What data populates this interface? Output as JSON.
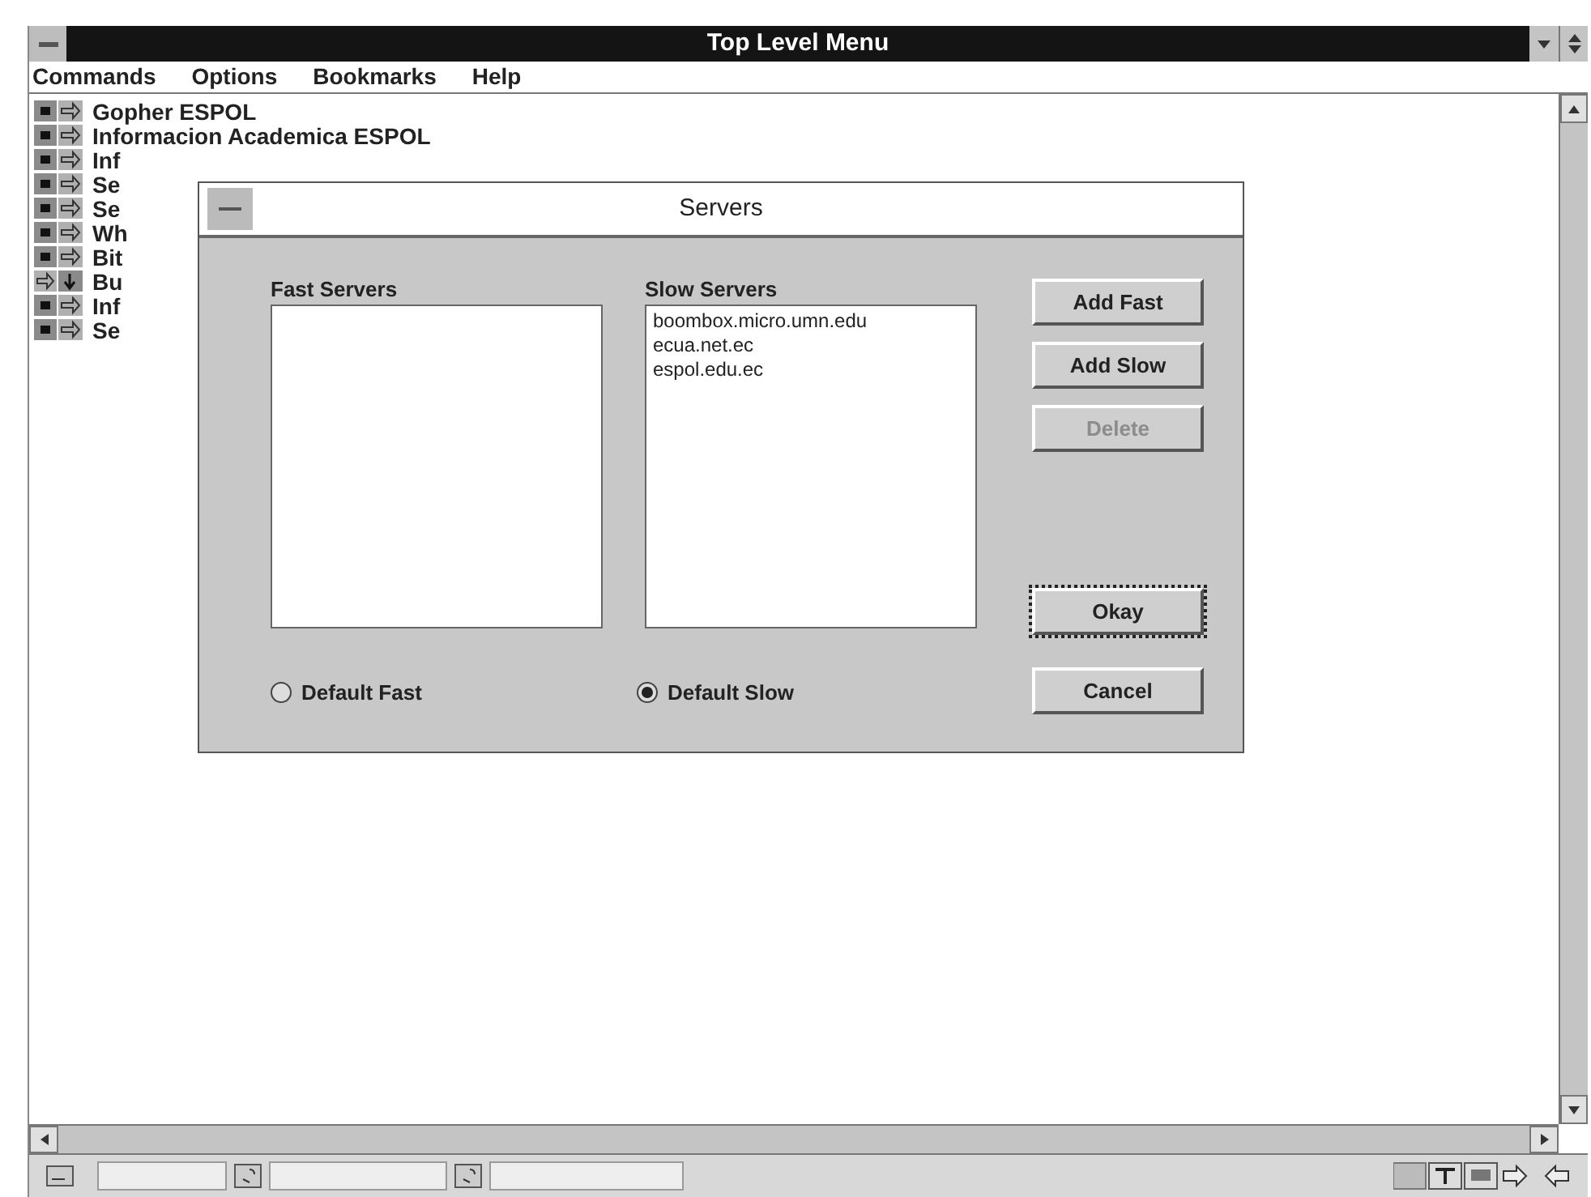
{
  "window": {
    "title": "Top Level Menu"
  },
  "menu": [
    {
      "label": "Commands"
    },
    {
      "label": "Options"
    },
    {
      "label": "Bookmarks"
    },
    {
      "label": "Help"
    }
  ],
  "items": [
    {
      "label": "Gopher ESPOL",
      "kind": "directory"
    },
    {
      "label": "Informacion Academica ESPOL",
      "kind": "directory"
    },
    {
      "label": "Inf",
      "kind": "directory"
    },
    {
      "label": "Se",
      "kind": "directory"
    },
    {
      "label": "Se",
      "kind": "directory"
    },
    {
      "label": "Wh",
      "kind": "directory"
    },
    {
      "label": "Bit",
      "kind": "directory"
    },
    {
      "label": "Bu",
      "kind": "search"
    },
    {
      "label": "Inf",
      "kind": "directory"
    },
    {
      "label": "Se",
      "kind": "directory"
    }
  ],
  "dialog": {
    "title": "Servers",
    "fast_servers": {
      "label": "Fast Servers"
    },
    "slow_servers": {
      "label": "Slow Servers",
      "items": [
        "boombox.micro.umn.edu",
        "ecua.net.ec",
        "espol.edu.ec"
      ]
    },
    "radios": [
      {
        "label": "Default Fast",
        "selected": false
      },
      {
        "label": "Default Slow",
        "selected": true
      }
    ],
    "buttons": [
      {
        "label": "Add Fast",
        "disabled": false,
        "default": false
      },
      {
        "label": "Add Slow",
        "disabled": false,
        "default": false
      },
      {
        "label": "Delete",
        "disabled": true,
        "default": false
      }
    ],
    "bottom_buttons": [
      {
        "label": "Okay",
        "disabled": false,
        "default": true
      },
      {
        "label": "Cancel",
        "disabled": false,
        "default": false
      }
    ]
  }
}
